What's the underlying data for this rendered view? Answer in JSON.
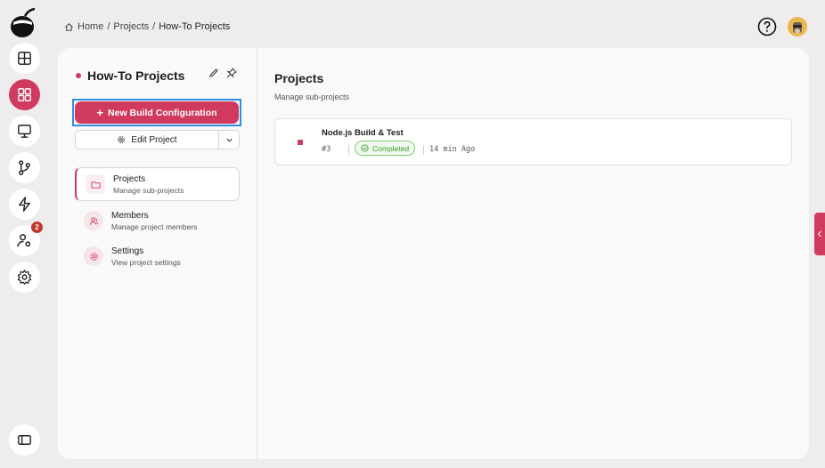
{
  "breadcrumb": {
    "items": [
      "Home",
      "/",
      "Projects",
      "/",
      "How-To Projects"
    ]
  },
  "rail": {
    "notification_count": "2"
  },
  "sidebar": {
    "project_title": "How-To Projects",
    "new_build_label": "New Build Configuration",
    "edit_project_label": "Edit Project",
    "nav": [
      {
        "title": "Projects",
        "subtitle": "Manage sub-projects",
        "icon": "folder-icon"
      },
      {
        "title": "Members",
        "subtitle": "Manage project members",
        "icon": "members-icon"
      },
      {
        "title": "Settings",
        "subtitle": "View project settings",
        "icon": "settings-icon"
      }
    ]
  },
  "main": {
    "title": "Projects",
    "subtitle": "Manage sub-projects",
    "builds": [
      {
        "name": "Node.js Build & Test",
        "number": "#3",
        "status": "Completed",
        "time": "14 min Ago"
      }
    ]
  },
  "colors": {
    "accent": "#d03a5f",
    "success": "#3b9b29",
    "selection": "#2f8fe0"
  }
}
